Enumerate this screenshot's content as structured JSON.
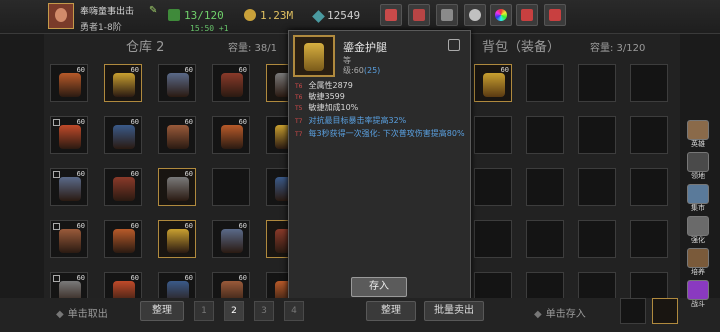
{
  "player": {
    "name": "奉嗨童事出击",
    "rank": "勇者1-8阶",
    "timer": "15:50 +1"
  },
  "stats": {
    "energy": "13/120",
    "gold": "1.23M",
    "gems": "12549"
  },
  "colors": {
    "gold_border": "#b08a3e",
    "accent_blue": "#5aa0e0",
    "tag_red": "#d04a4a"
  },
  "toolbar_icons": [
    "shop-icon",
    "mail-icon",
    "gamepad-icon",
    "gear-icon",
    "color-wheel-icon",
    "alert-icon",
    "x-icon"
  ],
  "warehouse": {
    "title": "仓库 2",
    "capacity": "容量: 38/1"
  },
  "backpack": {
    "title": "背包（装备）",
    "capacity": "容量: 3/120"
  },
  "popup": {
    "name": "鎏金护腿",
    "quality": "等",
    "level_prefix": "级:60",
    "level_extra": "(25)",
    "attrs": [
      {
        "tag": "T6",
        "text": "全属性2879"
      },
      {
        "tag": "T6",
        "text": "敏捷3599"
      },
      {
        "tag": "T5",
        "text": "敏捷加成10%"
      },
      {
        "tag": "T7",
        "text": "对抗最目标暴击率提高32%"
      },
      {
        "tag": "T7",
        "text": "每3秒获得一次强化: 下次普攻伤害提高80%"
      }
    ],
    "store_button": "存入"
  },
  "bottom": {
    "left_hint": "单击取出",
    "sort_left": "整理",
    "pages": [
      "1",
      "2",
      "3",
      "4"
    ],
    "active_page": "2",
    "sort_right": "整理",
    "batch_sell": "批量卖出",
    "right_hint": "单击存入"
  },
  "side_menu": [
    {
      "label": "英雄",
      "icon": "hero-icon"
    },
    {
      "label": "领地",
      "icon": "territory-icon"
    },
    {
      "label": "集市",
      "icon": "market-icon"
    },
    {
      "label": "强化",
      "icon": "enhance-icon"
    },
    {
      "label": "培养",
      "icon": "train-icon"
    },
    {
      "label": "战斗",
      "icon": "battle-icon"
    }
  ],
  "slot_level": "60"
}
